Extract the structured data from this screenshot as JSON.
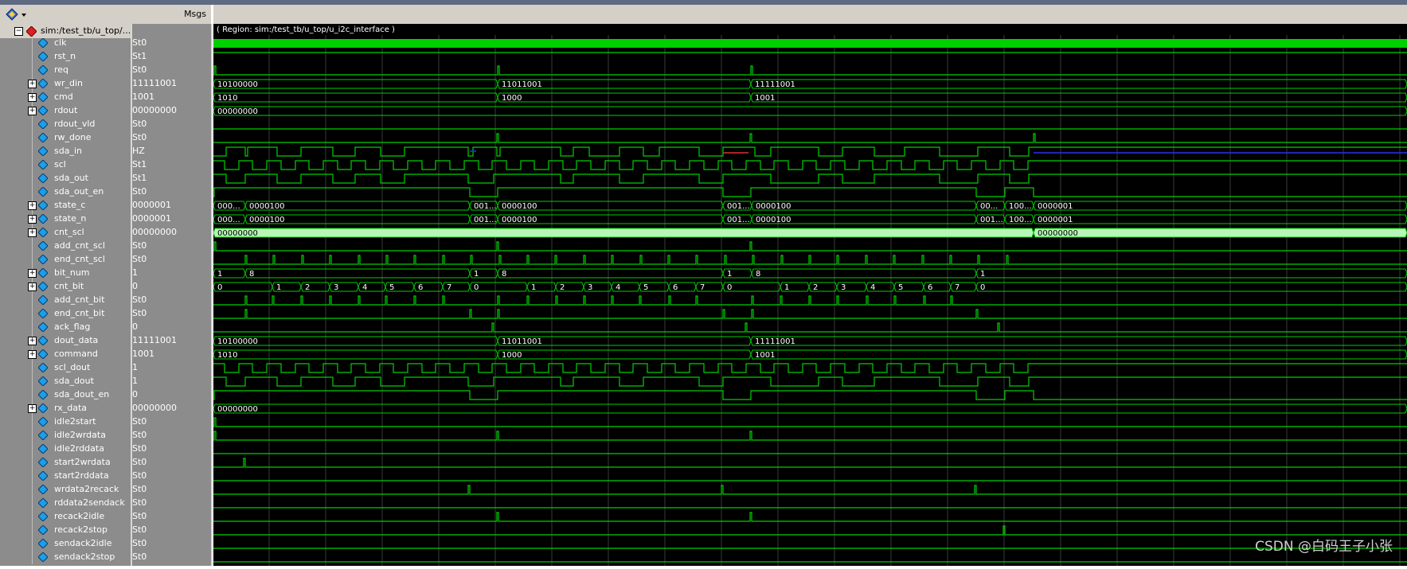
{
  "window": {
    "msgs_header": "Msgs"
  },
  "root": {
    "label": "sim:/test_tb/u_top/..."
  },
  "region_label": "( Region: sim:/test_tb/u_top/u_i2c_interface )",
  "watermark": "CSDN @白码王子小张",
  "colors": {
    "wave": "#00d000",
    "bus_bg": "#b9f5b9",
    "hz": "#2d2df5",
    "x": "#e03030"
  },
  "signals": [
    {
      "name": "clk",
      "value": "St0",
      "bus": false
    },
    {
      "name": "rst_n",
      "value": "St1",
      "bus": false
    },
    {
      "name": "req",
      "value": "St0",
      "bus": false
    },
    {
      "name": "wr_din",
      "value": "11111001",
      "bus": true
    },
    {
      "name": "cmd",
      "value": "1001",
      "bus": true
    },
    {
      "name": "rdout",
      "value": "00000000",
      "bus": true
    },
    {
      "name": "rdout_vld",
      "value": "St0",
      "bus": false
    },
    {
      "name": "rw_done",
      "value": "St0",
      "bus": false
    },
    {
      "name": "sda_in",
      "value": "HZ",
      "bus": false
    },
    {
      "name": "scl",
      "value": "St1",
      "bus": false
    },
    {
      "name": "sda_out",
      "value": "St1",
      "bus": false
    },
    {
      "name": "sda_out_en",
      "value": "St0",
      "bus": false
    },
    {
      "name": "state_c",
      "value": "0000001",
      "bus": true
    },
    {
      "name": "state_n",
      "value": "0000001",
      "bus": true
    },
    {
      "name": "cnt_scl",
      "value": "00000000",
      "bus": true
    },
    {
      "name": "add_cnt_scl",
      "value": "St0",
      "bus": false
    },
    {
      "name": "end_cnt_scl",
      "value": "St0",
      "bus": false
    },
    {
      "name": "bit_num",
      "value": "1",
      "bus": true
    },
    {
      "name": "cnt_bit",
      "value": "0",
      "bus": true
    },
    {
      "name": "add_cnt_bit",
      "value": "St0",
      "bus": false
    },
    {
      "name": "end_cnt_bit",
      "value": "St0",
      "bus": false
    },
    {
      "name": "ack_flag",
      "value": "0",
      "bus": false
    },
    {
      "name": "dout_data",
      "value": "11111001",
      "bus": true
    },
    {
      "name": "command",
      "value": "1001",
      "bus": true
    },
    {
      "name": "scl_dout",
      "value": "1",
      "bus": false
    },
    {
      "name": "sda_dout",
      "value": "1",
      "bus": false
    },
    {
      "name": "sda_dout_en",
      "value": "0",
      "bus": false
    },
    {
      "name": "rx_data",
      "value": "00000000",
      "bus": true
    },
    {
      "name": "idle2start",
      "value": "St0",
      "bus": false
    },
    {
      "name": "idle2wrdata",
      "value": "St0",
      "bus": false
    },
    {
      "name": "idle2rddata",
      "value": "St0",
      "bus": false
    },
    {
      "name": "start2wrdata",
      "value": "St0",
      "bus": false
    },
    {
      "name": "start2rddata",
      "value": "St0",
      "bus": false
    },
    {
      "name": "wrdata2recack",
      "value": "St0",
      "bus": false
    },
    {
      "name": "rddata2sendack",
      "value": "St0",
      "bus": false
    },
    {
      "name": "recack2idle",
      "value": "St0",
      "bus": false
    },
    {
      "name": "recack2stop",
      "value": "St0",
      "bus": false
    },
    {
      "name": "sendack2idle",
      "value": "St0",
      "bus": false
    },
    {
      "name": "sendack2stop",
      "value": "St0",
      "bus": false
    }
  ],
  "bus_labels": {
    "wr_din": [
      "10100000",
      "11011001",
      "11111001"
    ],
    "cmd": [
      "1010",
      "1000",
      "1001"
    ],
    "rdout": [
      "00000000"
    ],
    "state_c": [
      "000...",
      "0000100",
      "001...",
      "0000100",
      "001...",
      "0000100",
      "00...",
      "100...",
      "0000001"
    ],
    "state_n": [
      "000...",
      "0000100",
      "001...",
      "0000100",
      "001...",
      "0000100",
      "001...",
      "100...",
      "0000001"
    ],
    "cnt_scl": [
      "00000000"
    ],
    "bit_num": [
      "1",
      "8",
      "1",
      "8",
      "1",
      "8",
      "1"
    ],
    "cnt_bit": [
      "0",
      "1",
      "2",
      "3",
      "4",
      "5",
      "6",
      "7",
      "0",
      "1",
      "2",
      "3",
      "4",
      "5",
      "6",
      "7",
      "0",
      "1",
      "2",
      "3",
      "4",
      "5",
      "6",
      "7",
      "0"
    ],
    "dout_data": [
      "10100000",
      "11011001",
      "11111001"
    ],
    "command": [
      "1010",
      "1000",
      "1001"
    ],
    "rx_data": [
      "00000000"
    ]
  }
}
